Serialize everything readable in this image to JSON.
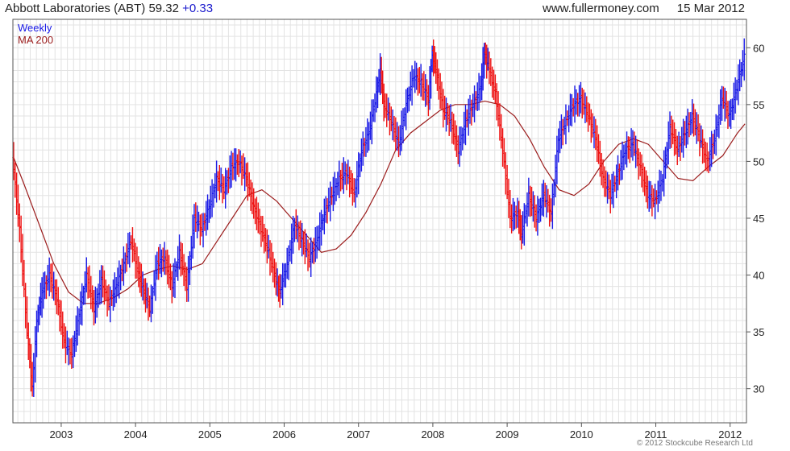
{
  "header": {
    "title": "Abbott Laboratories (ABT)",
    "price": "59.32",
    "change": "+0.33",
    "website": "www.fullermoney.com",
    "date": "15 Mar 2012"
  },
  "legend": {
    "weekly": "Weekly",
    "ma": "MA 200"
  },
  "copyright": "© 2012 Stockcube Research Ltd",
  "colors": {
    "up": "#1a1ae6",
    "down": "#ee1111",
    "ma": "#9b1c1c",
    "grid": "#e3e3e3",
    "axis": "#555555",
    "change": "#1a1acc"
  },
  "chart_data": {
    "type": "line",
    "title": "Abbott Laboratories (ABT) 59.32 +0.33",
    "xlabel": "",
    "ylabel": "",
    "x_ticks": [
      "2003",
      "2004",
      "2005",
      "2006",
      "2007",
      "2008",
      "2009",
      "2010",
      "2011",
      "2012"
    ],
    "y_ticks": [
      30,
      35,
      40,
      45,
      50,
      55,
      60
    ],
    "xlim": [
      2002.35,
      2012.22
    ],
    "ylim": [
      27,
      62.5
    ],
    "grid": true,
    "legend_position": "top-left",
    "series": [
      {
        "name": "Weekly",
        "x": [
          2002.35,
          2002.45,
          2002.55,
          2002.62,
          2002.68,
          2002.75,
          2002.85,
          2002.95,
          2003.05,
          2003.15,
          2003.25,
          2003.35,
          2003.45,
          2003.55,
          2003.65,
          2003.75,
          2003.85,
          2003.95,
          2004.05,
          2004.2,
          2004.3,
          2004.4,
          2004.5,
          2004.6,
          2004.7,
          2004.8,
          2004.9,
          2005.0,
          2005.1,
          2005.2,
          2005.3,
          2005.4,
          2005.5,
          2005.6,
          2005.7,
          2005.8,
          2005.9,
          2005.95,
          2006.05,
          2006.15,
          2006.25,
          2006.35,
          2006.45,
          2006.55,
          2006.65,
          2006.75,
          2006.85,
          2006.95,
          2007.05,
          2007.15,
          2007.25,
          2007.3,
          2007.35,
          2007.45,
          2007.55,
          2007.65,
          2007.75,
          2007.85,
          2007.95,
          2008.0,
          2008.05,
          2008.15,
          2008.25,
          2008.35,
          2008.45,
          2008.55,
          2008.65,
          2008.7,
          2008.75,
          2008.85,
          2008.95,
          2009.05,
          2009.15,
          2009.2,
          2009.3,
          2009.4,
          2009.5,
          2009.6,
          2009.7,
          2009.8,
          2009.9,
          2010.0,
          2010.1,
          2010.2,
          2010.3,
          2010.4,
          2010.5,
          2010.6,
          2010.7,
          2010.8,
          2010.9,
          2011.0,
          2011.1,
          2011.2,
          2011.3,
          2011.4,
          2011.5,
          2011.6,
          2011.7,
          2011.8,
          2011.9,
          2012.0,
          2012.1,
          2012.2
        ],
        "values": [
          50.5,
          44,
          35,
          30,
          36,
          38.5,
          40,
          38,
          34,
          33,
          36.5,
          40,
          37,
          39.5,
          37.5,
          39,
          41,
          43,
          40,
          37,
          41,
          41.5,
          39,
          42,
          39,
          45,
          44,
          46,
          48.5,
          47.5,
          49.5,
          50,
          48.5,
          46,
          44,
          42,
          39.5,
          38.5,
          41,
          44.5,
          43,
          41.5,
          43,
          45.5,
          47,
          48.5,
          49,
          47,
          51,
          52.5,
          56,
          58,
          55,
          53.5,
          51.5,
          55,
          57.5,
          57,
          55.5,
          59.5,
          58,
          54.5,
          53.5,
          51,
          53.5,
          55,
          56.5,
          59.5,
          58.5,
          56,
          51,
          45,
          45.5,
          43.5,
          47,
          45,
          47,
          45.5,
          52,
          53.5,
          55,
          55.5,
          54,
          52,
          48.5,
          47,
          49,
          51,
          51.5,
          49.5,
          47,
          46.5,
          48.5,
          53,
          51,
          52.5,
          54,
          52,
          50,
          52,
          55.5,
          54,
          56.5,
          59.3
        ]
      },
      {
        "name": "MA 200",
        "x": [
          2002.35,
          2002.5,
          2002.7,
          2002.9,
          2003.1,
          2003.3,
          2003.5,
          2003.7,
          2003.9,
          2004.1,
          2004.3,
          2004.5,
          2004.7,
          2004.9,
          2005.1,
          2005.3,
          2005.5,
          2005.7,
          2005.9,
          2006.1,
          2006.3,
          2006.5,
          2006.7,
          2006.9,
          2007.1,
          2007.3,
          2007.5,
          2007.7,
          2007.9,
          2008.1,
          2008.3,
          2008.5,
          2008.7,
          2008.9,
          2009.1,
          2009.3,
          2009.5,
          2009.7,
          2009.9,
          2010.1,
          2010.3,
          2010.5,
          2010.7,
          2010.9,
          2011.1,
          2011.3,
          2011.5,
          2011.7,
          2011.9,
          2012.1,
          2012.2
        ],
        "values": [
          50.5,
          48,
          44.5,
          41,
          38.5,
          37.5,
          37.5,
          38,
          38.8,
          40,
          40.5,
          40.8,
          40.5,
          41,
          43,
          45,
          47,
          47.5,
          46.5,
          45,
          43.5,
          42,
          42.3,
          43.5,
          45.5,
          48,
          51,
          52.5,
          53.5,
          54.5,
          55,
          55,
          55.3,
          55,
          54,
          52,
          49.5,
          47.5,
          47,
          48,
          50,
          51.5,
          52,
          51.5,
          50,
          48.5,
          48.3,
          49.5,
          50.5,
          52.5,
          53.3
        ]
      }
    ]
  }
}
